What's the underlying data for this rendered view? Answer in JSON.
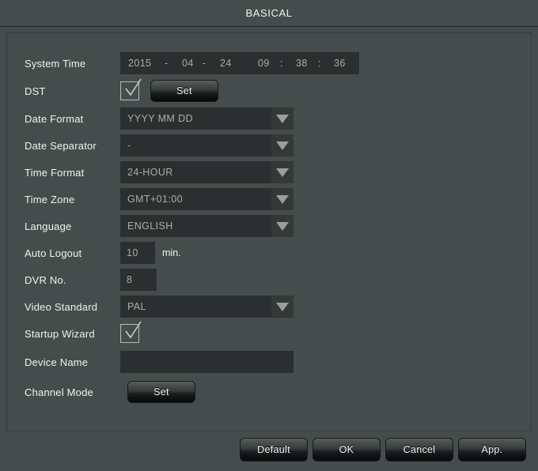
{
  "window": {
    "title": "BASICAL"
  },
  "form": {
    "system_time": {
      "label": "System Time",
      "year": "2015",
      "sep1": "-",
      "month": "04",
      "sep2": "-",
      "day": "24",
      "hour": "09",
      "colon1": ":",
      "minute": "38",
      "colon2": ":",
      "second": "36"
    },
    "dst": {
      "label": "DST",
      "checked": "true",
      "set_label": "Set"
    },
    "date_format": {
      "label": "Date Format",
      "value": "YYYY MM DD"
    },
    "date_separator": {
      "label": "Date Separator",
      "value": "-"
    },
    "time_format": {
      "label": "Time Format",
      "value": "24-HOUR"
    },
    "time_zone": {
      "label": "Time Zone",
      "value": "GMT+01:00"
    },
    "language": {
      "label": "Language",
      "value": "ENGLISH"
    },
    "auto_logout": {
      "label": "Auto Logout",
      "value": "10",
      "unit": "min."
    },
    "dvr_no": {
      "label": "DVR No.",
      "value": "8"
    },
    "video_standard": {
      "label": "Video Standard",
      "value": "PAL"
    },
    "startup_wizard": {
      "label": "Startup Wizard",
      "checked": "true"
    },
    "device_name": {
      "label": "Device Name",
      "value": ""
    },
    "channel_mode": {
      "label": "Channel Mode",
      "set_label": "Set"
    }
  },
  "buttons": {
    "default": "Default",
    "ok": "OK",
    "cancel": "Cancel",
    "apply": "App."
  },
  "colors": {
    "background": "#454d4c",
    "field": "#2b2f2f",
    "text": "#eef2f1",
    "value_text": "#a9aeac"
  }
}
